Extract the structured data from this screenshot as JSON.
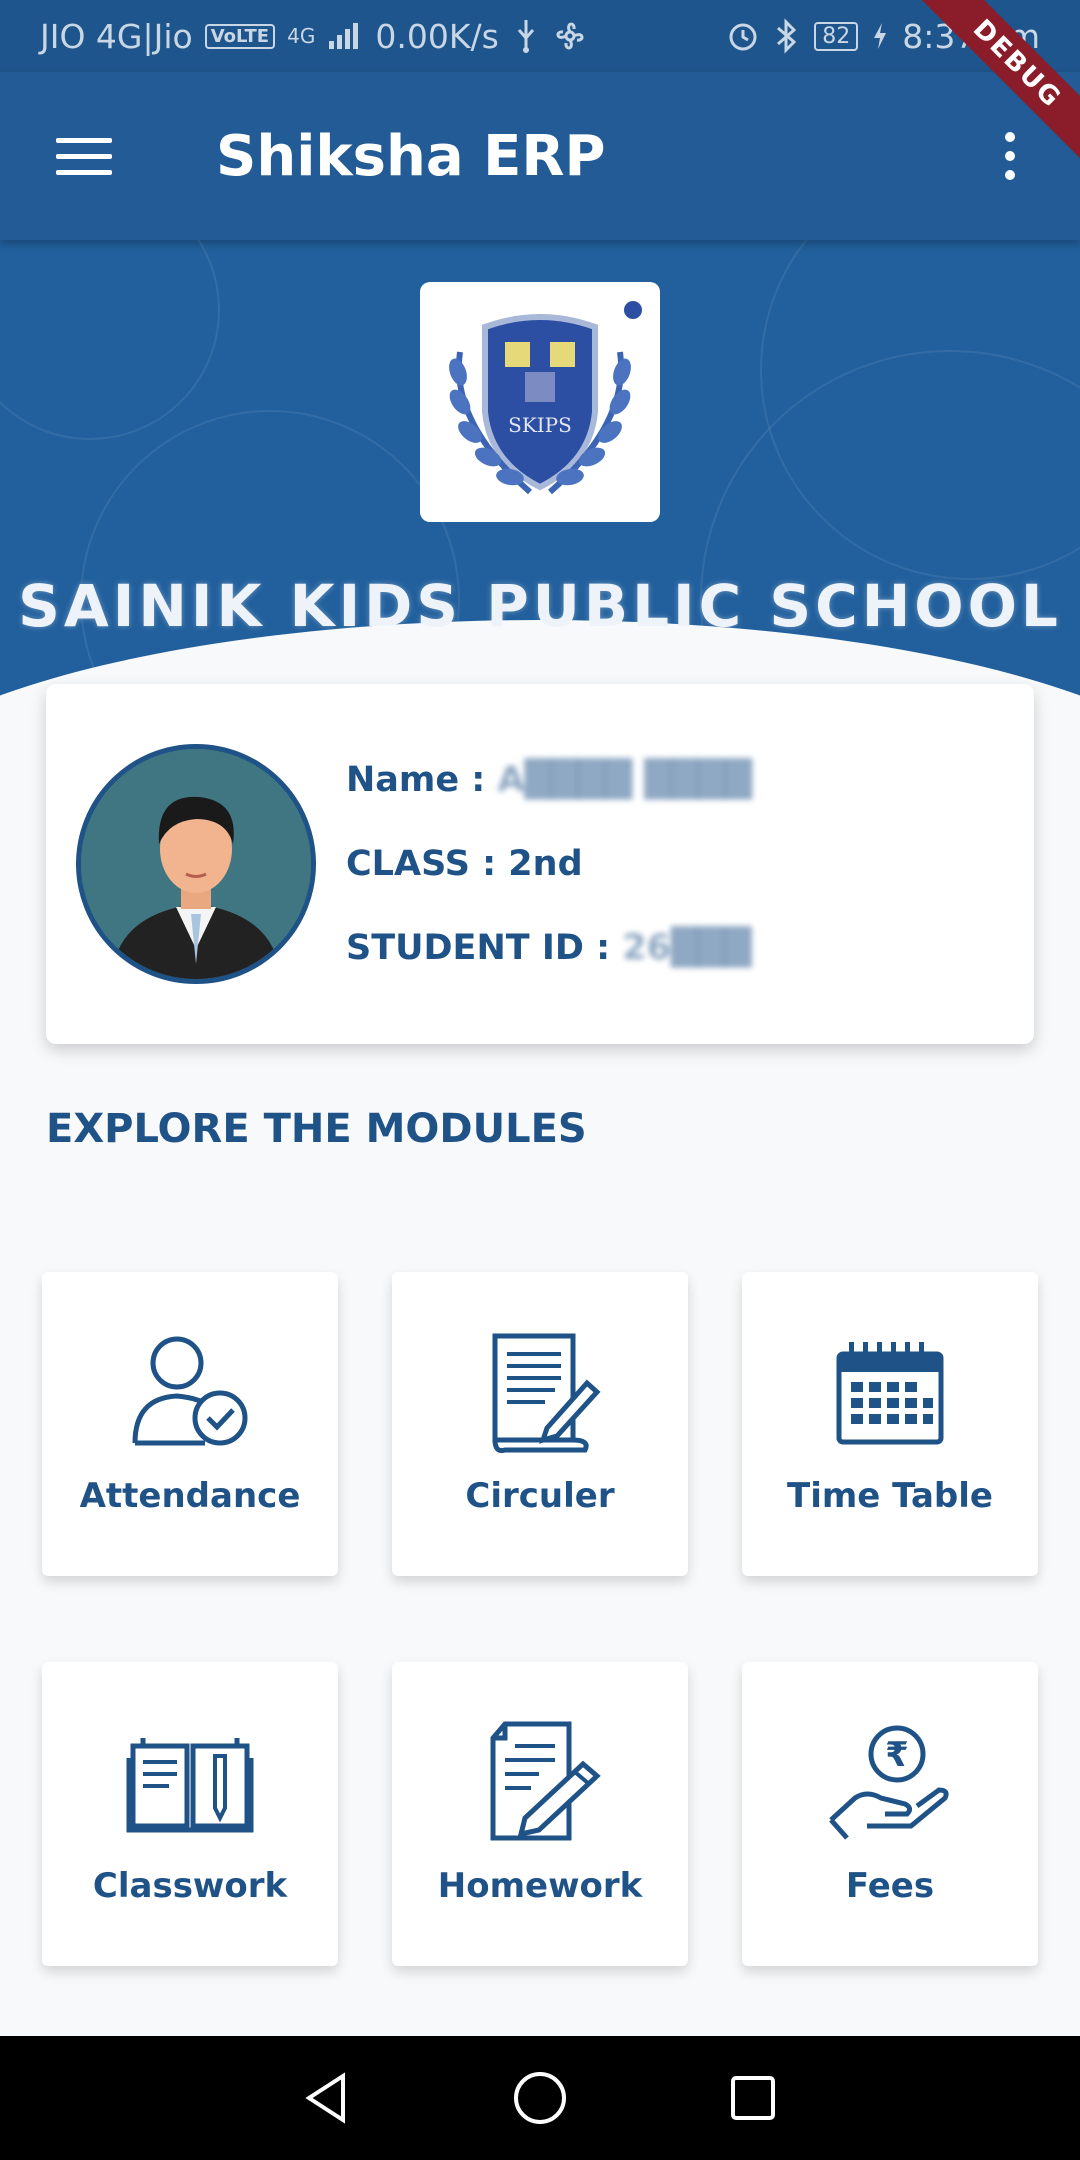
{
  "status_bar": {
    "carrier": "JIO 4G|Jio",
    "volte": "VoLTE",
    "network": "4G",
    "speed": "0.00K/s",
    "battery": "82",
    "time": "8:37 pm"
  },
  "debug_label": "DEBUG",
  "app_bar": {
    "title": "Shiksha ERP"
  },
  "school": {
    "name": "SAINIK KIDS PUBLIC SCHOOL",
    "logo_text": "SKIPS"
  },
  "profile": {
    "name_label": "Name :",
    "name_value": "A████ ████",
    "class_label": "CLASS :",
    "class_value": "2nd",
    "student_id_label": "STUDENT ID :",
    "student_id_value": "26███"
  },
  "section_title": "EXPLORE THE MODULES",
  "modules": [
    {
      "label": "Attendance",
      "icon": "attendance-icon"
    },
    {
      "label": "Circuler",
      "icon": "circular-icon"
    },
    {
      "label": "Time Table",
      "icon": "calendar-icon"
    },
    {
      "label": "Classwork",
      "icon": "book-icon"
    },
    {
      "label": "Homework",
      "icon": "homework-icon"
    },
    {
      "label": "Fees",
      "icon": "fees-icon"
    }
  ],
  "colors": {
    "primary": "#225b95",
    "text_primary": "#1f5287",
    "background": "#f7f9fb"
  }
}
